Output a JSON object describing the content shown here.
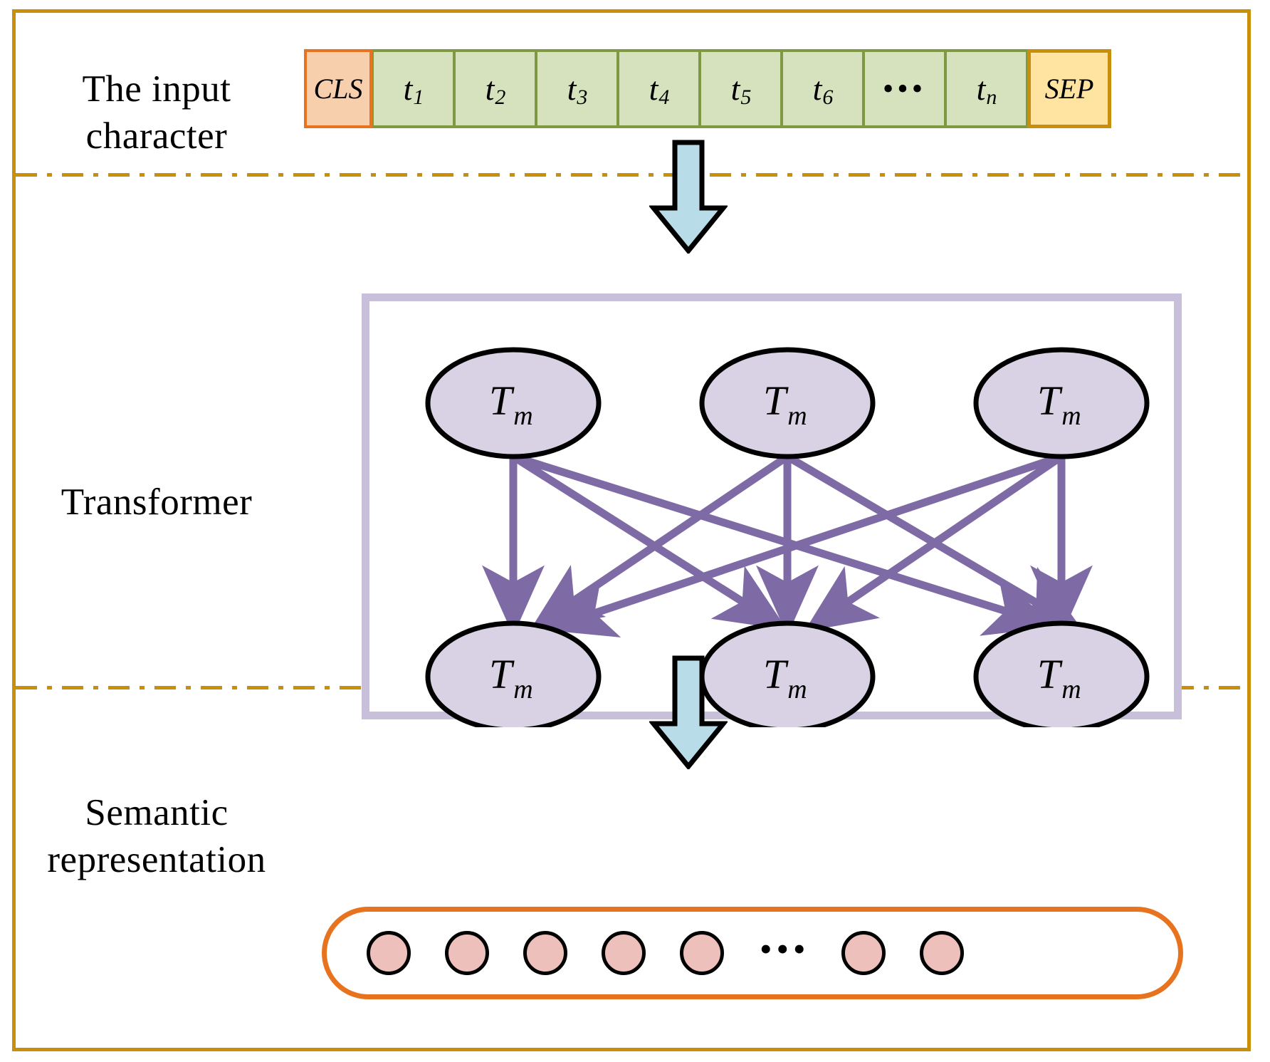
{
  "diagram": {
    "title": "BERT-style transformer encoding diagram",
    "colors": {
      "outer_border": "#c8900a",
      "divider": "#c8900a",
      "cls_fill": "#f8cfad",
      "cls_border": "#e8731e",
      "token_fill": "#d6e2bd",
      "token_border": "#7f9943",
      "sep_fill": "#ffe3a0",
      "sep_border": "#c8900a",
      "arrow_blue_fill": "#b8dce8",
      "arrow_blue_border": "#000000",
      "transformer_box_border": "#c8c0da",
      "node_fill": "#d8d2e4",
      "node_border": "#000000",
      "attention_line": "#7e6aa5",
      "capsule_border": "#e8731e",
      "semantic_dot_fill": "#eec0bc",
      "semantic_dot_border": "#000000"
    }
  },
  "sections": {
    "input": {
      "label": "The input\ncharacter"
    },
    "transformer": {
      "label": "Transformer"
    },
    "semantic": {
      "label": "Semantic\nrepresentation"
    }
  },
  "input_sequence": {
    "tokens": [
      {
        "type": "special",
        "text": "CLS"
      },
      {
        "type": "token",
        "base": "t",
        "sub": "1"
      },
      {
        "type": "token",
        "base": "t",
        "sub": "2"
      },
      {
        "type": "token",
        "base": "t",
        "sub": "3"
      },
      {
        "type": "token",
        "base": "t",
        "sub": "4"
      },
      {
        "type": "token",
        "base": "t",
        "sub": "5"
      },
      {
        "type": "token",
        "base": "t",
        "sub": "6"
      },
      {
        "type": "ellipsis",
        "text": "•••"
      },
      {
        "type": "token",
        "base": "t",
        "sub": "n"
      },
      {
        "type": "special",
        "text": "SEP"
      }
    ]
  },
  "arrows": {
    "input_to_transformer": {
      "name": "down-arrow",
      "direction": "down"
    },
    "transformer_to_semantic": {
      "name": "down-arrow",
      "direction": "down"
    }
  },
  "transformer_block": {
    "top_nodes": [
      {
        "base": "T",
        "sub": "m"
      },
      {
        "base": "T",
        "sub": "m"
      },
      {
        "base": "T",
        "sub": "m"
      }
    ],
    "bottom_nodes": [
      {
        "base": "T",
        "sub": "m"
      },
      {
        "base": "T",
        "sub": "m"
      },
      {
        "base": "T",
        "sub": "m"
      }
    ],
    "connections": "fully-connected self-attention: each top node points to every bottom node"
  },
  "semantic_representation": {
    "items": [
      {
        "type": "dot"
      },
      {
        "type": "dot"
      },
      {
        "type": "dot"
      },
      {
        "type": "dot"
      },
      {
        "type": "dot"
      },
      {
        "type": "ellipsis",
        "text": "•••"
      },
      {
        "type": "dot"
      },
      {
        "type": "dot"
      }
    ]
  }
}
